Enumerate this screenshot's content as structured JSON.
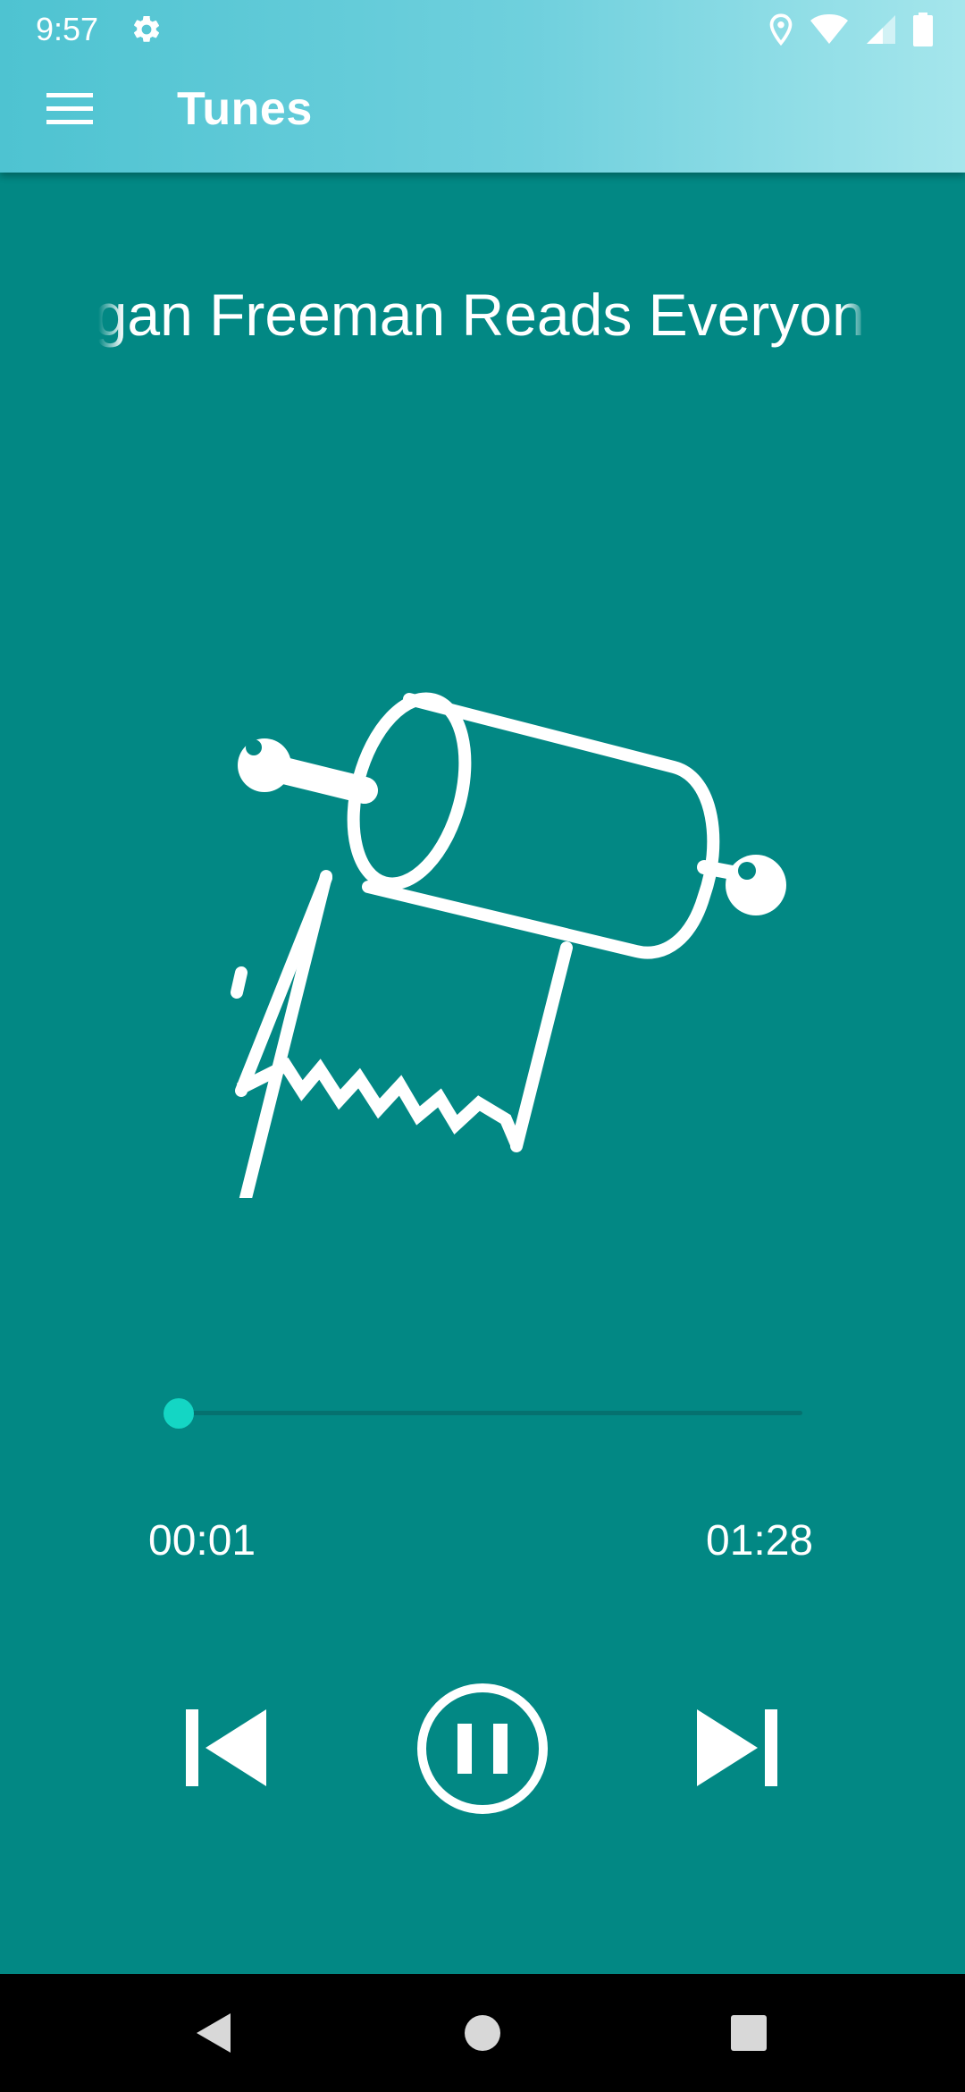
{
  "status_bar": {
    "time": "9:57",
    "left_icons": [
      "settings-gear-icon"
    ],
    "right_icons": [
      "location-icon",
      "wifi-icon",
      "signal-icon",
      "battery-icon"
    ]
  },
  "app_bar": {
    "title": "Tunes",
    "menu_icon": "hamburger-menu-icon"
  },
  "player": {
    "track_title": "Morgan Freeman Reads Everyone's Name",
    "artwork_icon": "toilet-paper-roll-icon",
    "elapsed": "00:01",
    "duration": "01:28",
    "progress_fraction": 0.011,
    "controls": {
      "previous_icon": "skip-previous-icon",
      "play_pause_icon": "pause-circle-icon",
      "next_icon": "skip-next-icon"
    }
  },
  "nav_bar": {
    "buttons": [
      "back-triangle-icon",
      "home-circle-icon",
      "recents-square-icon"
    ]
  },
  "colors": {
    "background": "#028884",
    "app_bar_start": "#4ec3d1",
    "app_bar_end": "#a5e6ec",
    "accent": "#14d6c4",
    "seek_track": "#05716f",
    "foreground": "#ffffff",
    "nav_bar": "#000000"
  }
}
